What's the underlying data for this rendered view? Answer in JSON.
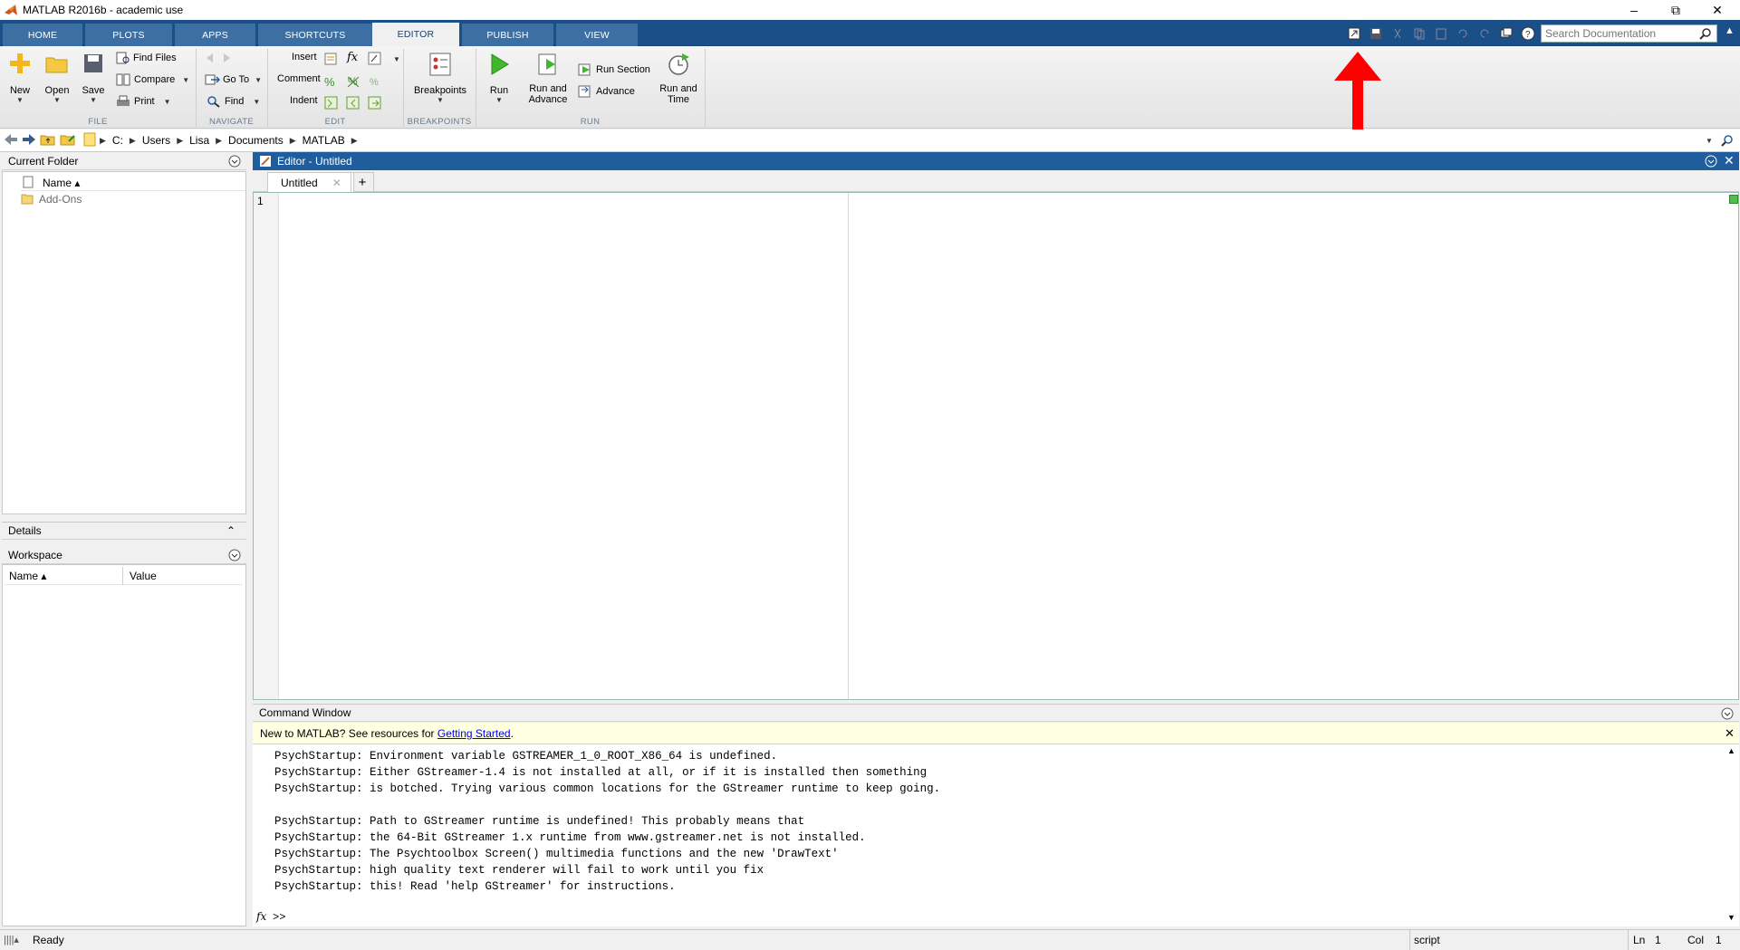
{
  "window": {
    "title": "MATLAB R2016b - academic use"
  },
  "tabs": [
    "HOME",
    "PLOTS",
    "APPS",
    "SHORTCUTS",
    "EDITOR",
    "PUBLISH",
    "VIEW"
  ],
  "search": {
    "placeholder": "Search Documentation"
  },
  "ribbon": {
    "file": {
      "new": "New",
      "open": "Open",
      "save": "Save",
      "find_files": "Find Files",
      "compare": "Compare",
      "print": "Print",
      "group": "FILE"
    },
    "navigate": {
      "go_to": "Go To",
      "find": "Find",
      "group": "NAVIGATE"
    },
    "edit": {
      "insert": "Insert",
      "comment": "Comment",
      "indent": "Indent",
      "fx": "fx",
      "group": "EDIT"
    },
    "breakpoints": {
      "label": "Breakpoints",
      "group": "BREAKPOINTS"
    },
    "run": {
      "run": "Run",
      "run_advance_1": "Run and",
      "run_advance_2": "Advance",
      "run_section": "Run Section",
      "advance": "Advance",
      "run_time_1": "Run and",
      "run_time_2": "Time",
      "group": "RUN"
    }
  },
  "path": [
    "C:",
    "Users",
    "Lisa",
    "Documents",
    "MATLAB"
  ],
  "current_folder": {
    "title": "Current Folder",
    "name_col": "Name ▴",
    "items": [
      "Add-Ons"
    ]
  },
  "details": {
    "title": "Details"
  },
  "workspace": {
    "title": "Workspace",
    "name_col": "Name ▴",
    "value_col": "Value"
  },
  "editor": {
    "title": "Editor - Untitled",
    "tab": "Untitled",
    "line": "1"
  },
  "command_window": {
    "title": "Command Window",
    "banner_text": "New to MATLAB? See resources for ",
    "banner_link": "Getting Started",
    "banner_end": ".",
    "output": [
      "PsychStartup: Environment variable GSTREAMER_1_0_ROOT_X86_64 is undefined.",
      "PsychStartup: Either GStreamer-1.4 is not installed at all, or if it is installed then something",
      "PsychStartup: is botched. Trying various common locations for the GStreamer runtime to keep going.",
      "",
      "PsychStartup: Path to GStreamer runtime is undefined! This probably means that",
      "PsychStartup: the 64-Bit GStreamer 1.x runtime from www.gstreamer.net is not installed.",
      "PsychStartup: The Psychtoolbox Screen() multimedia functions and the new 'DrawText'",
      "PsychStartup: high quality text renderer will fail to work until you fix",
      "PsychStartup: this! Read 'help GStreamer' for instructions."
    ],
    "prompt": ">>",
    "fx": "fx"
  },
  "status": {
    "ready": "Ready",
    "type": "script",
    "ln_label": "Ln",
    "ln": "1",
    "col_label": "Col",
    "col": "1"
  },
  "colors": {
    "tabstrip": "#1a4f88",
    "editor_header": "#1f5d9c",
    "annotation_arrow": "#ff0000"
  }
}
